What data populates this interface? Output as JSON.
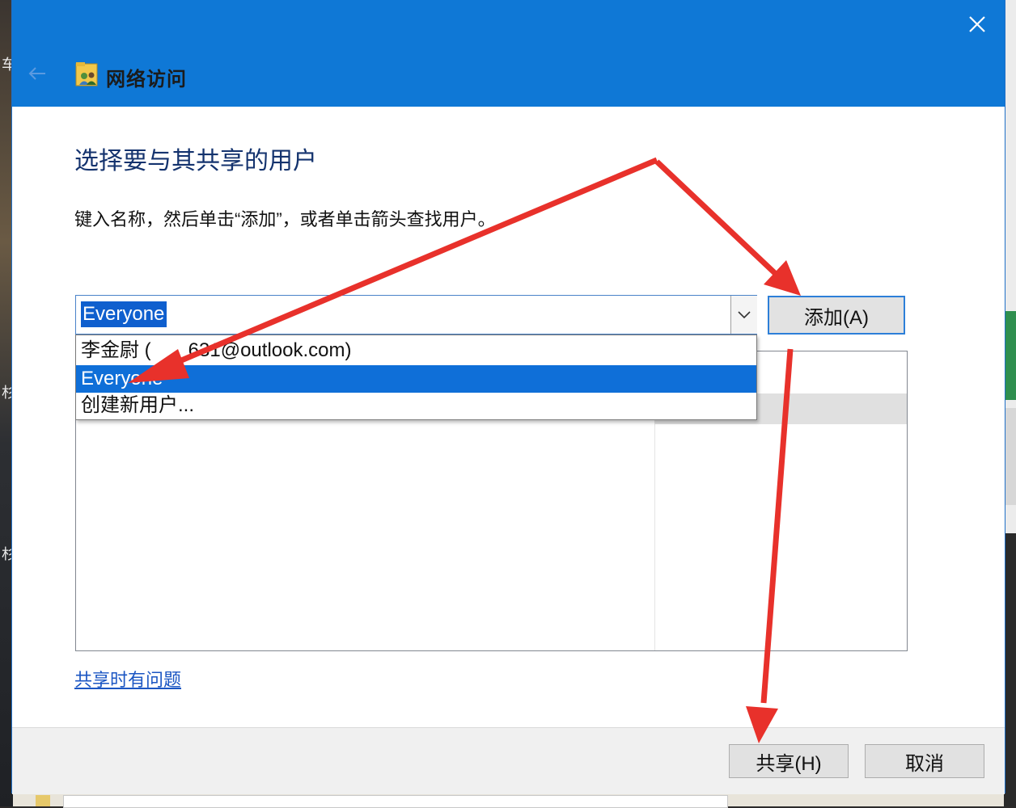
{
  "background": {
    "left_chars": [
      "车",
      "杉",
      "杉"
    ]
  },
  "window": {
    "title": "网络访问",
    "close_icon": "close-icon",
    "back_icon": "arrow-left-icon"
  },
  "main": {
    "heading": "选择要与其共享的用户",
    "instruction": "键入名称，然后单击“添加”，或者单击箭头查找用户。",
    "combo_value": "Everyone",
    "add_button": "添加(A)",
    "dropdown_items": [
      {
        "label": "李金尉 (",
        "selected": false
      },
      {
        "label": "Everyone",
        "selected": true
      },
      {
        "label": "创建新用户...",
        "selected": false
      }
    ],
    "dropdown_email_suffix": "631@outlook.com)",
    "help_link": "共享时有问题"
  },
  "footer": {
    "share_button": "共享(H)",
    "cancel_button": "取消"
  },
  "colors": {
    "titlebar": "#0f78d6",
    "selection": "#0f6fd8",
    "annotation_arrow": "#e8312b"
  }
}
